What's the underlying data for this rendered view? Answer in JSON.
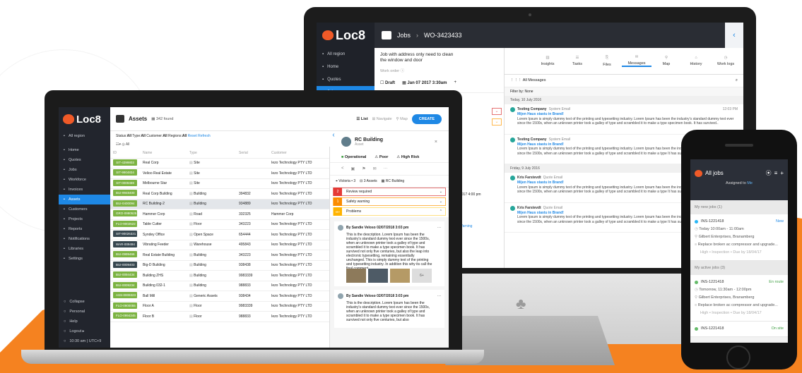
{
  "imac": {
    "logo": "Loc8",
    "breadcrumb": "Jobs",
    "work_order": "WO-3423433",
    "job_desc": "Job with address only need to clean the window and door",
    "work_order_label": "Work order",
    "status": "Draft",
    "date": "Jan 07 2017 3:30am",
    "nav": [
      {
        "label": "All region",
        "icon": "globe-icon"
      },
      {
        "label": "Home",
        "icon": "home-icon"
      },
      {
        "label": "Quotes",
        "icon": "quote-icon"
      },
      {
        "label": "Jobs",
        "icon": "jobs-icon"
      }
    ],
    "tabs": [
      "Insights",
      "Tasks",
      "Files",
      "Messages",
      "Map",
      "History",
      "Work logs"
    ],
    "active_tab": "Messages",
    "all_messages": "All Messages",
    "filter": "Filter by: None",
    "date1": "Today, 10 July 2016",
    "date2": "Friday, 9 July 2016",
    "partial_date": "2017 4:00 pm",
    "partial_warning": "Warning",
    "messages": [
      {
        "sender": "Testing Company",
        "type": "System Email",
        "subject": "Mijen Haus stastu in Brand!",
        "time": "12:03 PM",
        "body": "Lorem Ipsum is simply dummy text of the printing and typesetting industry. Lorem Ipsum has been the industry's standard dummy text ever since the 1500s, when an unknown printer took a galley of type and scrambled it to make a type specimen book. It has survived.."
      },
      {
        "sender": "Testing Company",
        "type": "System Email",
        "subject": "Mijen Haus stastu in Brand!",
        "time": "",
        "body": "Lorem Ipsum is simply dummy text of the printing and typesetting industry. Lorem Ipsum has been the industry's standard dummy text ever since the 1500s, when an unknown printer took a galley of type and scrambled it to make a type It has survived.."
      },
      {
        "sender": "Kris Farstevdt",
        "type": "Quote Email",
        "subject": "Mijen Haus stastu in Brand!",
        "time": "",
        "body": "Lorem Ipsum is simply dummy text of the printing and typesetting industry. Lorem Ipsum has been the industry's standard dummy text ever since the 1500s, when an unknown printer took a galley of type and scrambled it to make a type It has survived.."
      },
      {
        "sender": "Kris Farstevdt",
        "type": "Quote Email",
        "subject": "Mijen Haus stastu in Brand!",
        "time": "",
        "body": "Lorem Ipsum is simply dummy text of the printing and typesetting industry. Lorem Ipsum has been the industry's standard dummy text ever since the 1500s, when an unknown printer took a galley of type and scrambled it to make a type It has survived.."
      }
    ]
  },
  "laptop": {
    "logo": "Loc8",
    "title": "Assets",
    "count": "342 found",
    "list": "List",
    "navigate": "Navigate",
    "map": "Map",
    "create": "CREATE",
    "filters": {
      "status": "Status:",
      "status_v": "All",
      "type": "Type:",
      "type_v": "All",
      "customer": "Customer:",
      "customer_v": "All",
      "regions": "Regions:",
      "regions_v": "All",
      "reset": "Reset",
      "refresh": "Refresh",
      "all": "All"
    },
    "columns": [
      "ID",
      "Name",
      "Type",
      "Serial",
      "Customer"
    ],
    "rows": [
      {
        "id": "SIT-4399803",
        "name": "Real Corp",
        "type": "Site",
        "serial": "",
        "customer": "Iezo Technology PTY LTD",
        "c": "#7cb342"
      },
      {
        "id": "SIT-9904834",
        "name": "Velioo Real Estate",
        "type": "Site",
        "serial": "",
        "customer": "Iezo Technology PTY LTD",
        "c": "#7cb342"
      },
      {
        "id": "SIT-0009459",
        "name": "Melbourne Star",
        "type": "Site",
        "serial": "",
        "customer": "Iezo Technology PTY LTD",
        "c": "#7cb342"
      },
      {
        "id": "BUI-9948400",
        "name": "Real Corp Building",
        "type": "Building",
        "serial": "394832",
        "customer": "Iezo Technology PTY LTD",
        "c": "#7cb342"
      },
      {
        "id": "BUI-0400094",
        "name": "RC Building-2",
        "type": "Building",
        "serial": "934889",
        "customer": "Iezo Technology PTY LTD",
        "c": "#7cb342"
      },
      {
        "id": "GRO-0990525",
        "name": "Hammer Corp",
        "type": "Road",
        "serial": "332325",
        "customer": "Hammer Corp",
        "c": "#7cb342"
      },
      {
        "id": "FLO-9002522",
        "name": "Table Cutter",
        "type": "Floor",
        "serial": "343223",
        "customer": "Iezo Technology PTY LTD",
        "c": "#7cb342"
      },
      {
        "id": "SIT-90026321",
        "name": "Syndey Office",
        "type": "Open Space",
        "serial": "654444",
        "customer": "Iezo Technology PTY LTD",
        "c": "#37474f"
      },
      {
        "id": "WAR-009494",
        "name": "Vibrating Feeder",
        "type": "Warehouse",
        "serial": "495843",
        "customer": "Iezo Technology PTY LTD",
        "c": "#37474f"
      },
      {
        "id": "BUI-0999466",
        "name": "Real Estate Building",
        "type": "Building",
        "serial": "343223",
        "customer": "Iezo Technology PTY LTD",
        "c": "#7cb342"
      },
      {
        "id": "BUI-0009403",
        "name": "Big-D Building",
        "type": "Building",
        "serial": "938438",
        "customer": "Iezo Technology PTY LTD",
        "c": "#37474f"
      },
      {
        "id": "BUI-0094434",
        "name": "Building ZHS",
        "type": "Building",
        "serial": "9983339",
        "customer": "Iezo Technology PTY LTD",
        "c": "#7cb342"
      },
      {
        "id": "BUI-0009234",
        "name": "Building 032-1",
        "type": "Building",
        "serial": "988833",
        "customer": "Iezo Technology PTY LTD",
        "c": "#7cb342"
      },
      {
        "id": "ASS-0009323",
        "name": "Ball Mill",
        "type": "Generic Assets",
        "serial": "938434",
        "customer": "Iezo Technology PTY LTD",
        "c": "#7cb342"
      },
      {
        "id": "FLO-0900055",
        "name": "Floor A",
        "type": "Floor",
        "serial": "9983339",
        "customer": "Iezo Technology PTY LTD",
        "c": "#7cb342"
      },
      {
        "id": "FLO-0994345",
        "name": "Floor B",
        "type": "Floor",
        "serial": "988833",
        "customer": "Iezo Technology PTY LTD",
        "c": "#7cb342"
      }
    ],
    "nav": [
      {
        "label": "All region",
        "icon": "globe-icon"
      },
      {
        "label": "Home",
        "icon": "home-icon"
      },
      {
        "label": "Quotes",
        "icon": "quote-icon"
      },
      {
        "label": "Jobs",
        "icon": "jobs-icon"
      },
      {
        "label": "Workforce",
        "icon": "person-icon"
      },
      {
        "label": "Invoices",
        "icon": "invoice-icon"
      },
      {
        "label": "Assets",
        "icon": "assets-icon"
      },
      {
        "label": "Customers",
        "icon": "customers-icon"
      },
      {
        "label": "Projects",
        "icon": "projects-icon"
      },
      {
        "label": "Reports",
        "icon": "reports-icon"
      },
      {
        "label": "Notifications",
        "icon": "bell-icon"
      },
      {
        "label": "Libraries",
        "icon": "library-icon"
      },
      {
        "label": "Settings",
        "icon": "gear-icon"
      }
    ],
    "nav_bottom": [
      {
        "label": "Collapse",
        "icon": "collapse-icon"
      },
      {
        "label": "Personal",
        "icon": "person-icon"
      },
      {
        "label": "Help",
        "icon": "help-icon"
      },
      {
        "label": "Logout ▸",
        "icon": "logout-icon"
      },
      {
        "label": "10:30 am | UTC+9",
        "icon": "clock-icon"
      }
    ],
    "panel": {
      "title": "RC Building",
      "sub": "Asset",
      "operational": "Operational",
      "poor": "Poor",
      "risk": "High Risk",
      "loc": "Victoria",
      "loc_n": "3",
      "assets": "3 Assets",
      "building": "RC Building",
      "p1": "Review required",
      "p2": "Safety warning",
      "p3": "Problems",
      "n1": "2",
      "n2": "1",
      "n3": "99+",
      "comment_by": "By Sandie Veloso 02/07/2018 3:03 pm",
      "comment": "This is the description. Lorem Ipsum has been the industry's standard dummy text ever since the 1500s, when an unknown printer took a galley of type and scrambled it to make a type specimen book. It has survived not only five centuries, but also the leap into electronic typesetting, remaining essentially unchanged. This is simply dummy text of the printing and typesetting industry. In addition this why its call the final comment.",
      "more": "6+",
      "comment2": "This is the description. Lorem Ipsum has been the industry's standard dummy text ever since the 1500s, when an unknown printer took a galley of type and scrambled it to make a type specimen book. It has survived not only five centuries, but also"
    }
  },
  "phone": {
    "title": "All jobs",
    "assigned": "Assigned to",
    "assigned_who": "Me",
    "new_section": "My new jobs (1)",
    "active_section": "My active jobs (3)",
    "jobs": [
      {
        "id": "INS-1221418",
        "status": "New",
        "time": "Today 10:00am - 11:00am",
        "place": "Gilbert Enterprises, Branamberg",
        "task": "Replace broken ac compressor and upgrade...",
        "meta": "High • Inspection • Due by 18/04/17",
        "dot": "#29b6f6",
        "sc": "#1e88e5"
      },
      {
        "id": "INS-1221418",
        "status": "En route",
        "time": "Tomorrow, 11:30am - 12:00pm",
        "place": "Gilbert Enterprises, Branamberg",
        "task": "Replace broken ac compressor and upgrade...",
        "meta": "High • Inspection • Due by 18/04/17",
        "dot": "#66bb6a",
        "sc": "#43a047"
      },
      {
        "id": "INS-1221418",
        "status": "On site",
        "dot": "#66bb6a",
        "sc": "#43a047"
      }
    ]
  }
}
